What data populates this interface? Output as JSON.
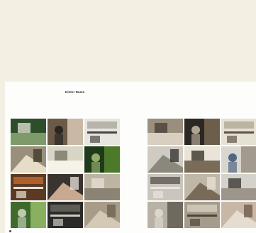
{
  "document": {
    "heading": "Dieter Rams",
    "photo_grids": [
      {
        "name": "left-grid",
        "rows": 4,
        "cols": 3,
        "photos": [
          "garden-pool-photo",
          "person-at-desk-photo",
          "kitchen-interior-photo",
          "shelving-interior-photo",
          "doorway-light-photo",
          "tree-garden-photo",
          "orange-chair-room-photo",
          "two-men-portrait-photo",
          "stone-wall-photo",
          "green-lawn-photo",
          "dark-interior-photo",
          "stone-wall-lower-photo"
        ]
      },
      {
        "name": "right-grid",
        "rows": 4,
        "cols": 3,
        "photos": [
          "living-room-photo",
          "bookcase-dark-photo",
          "hallway-bright-photo",
          "desk-corner-photo",
          "door-frame-photo",
          "man-reading-photo",
          "record-player-photo",
          "bookshelf-wall-photo",
          "cabinet-photo",
          "dining-room-photo",
          "library-shelves-photo",
          "man-portrait-photo"
        ]
      }
    ]
  }
}
